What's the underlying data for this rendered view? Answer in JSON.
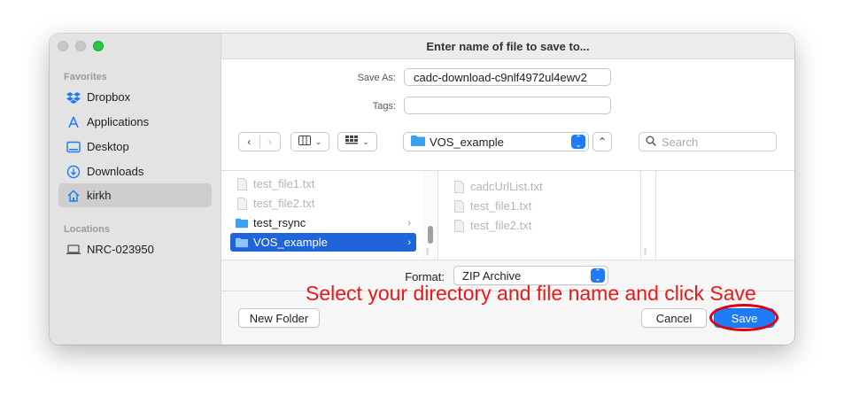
{
  "window": {
    "title": "Enter name of file to save to..."
  },
  "sidebar": {
    "favorites_heading": "Favorites",
    "favorites": [
      {
        "label": "Dropbox",
        "icon": "dropbox-icon"
      },
      {
        "label": "Applications",
        "icon": "applications-icon"
      },
      {
        "label": "Desktop",
        "icon": "desktop-icon"
      },
      {
        "label": "Downloads",
        "icon": "downloads-icon"
      },
      {
        "label": "kirkh",
        "icon": "home-icon",
        "selected": true
      }
    ],
    "locations_heading": "Locations",
    "locations": [
      {
        "label": "NRC-023950",
        "icon": "computer-icon"
      }
    ]
  },
  "form": {
    "save_as_label": "Save As:",
    "save_as_value": "cadc-download-c9nlf4972ul4ewv2",
    "tags_label": "Tags:",
    "tags_value": ""
  },
  "toolbar": {
    "location": "VOS_example",
    "search_placeholder": "Search"
  },
  "browser": {
    "column1": [
      {
        "label": "test_file1.txt",
        "kind": "file",
        "dimmed": true
      },
      {
        "label": "test_file2.txt",
        "kind": "file",
        "dimmed": true
      },
      {
        "label": "test_rsync",
        "kind": "folder"
      },
      {
        "label": "VOS_example",
        "kind": "folder",
        "selected": true
      }
    ],
    "column2": [
      {
        "label": "cadcUrlList.txt",
        "kind": "file",
        "dimmed": true
      },
      {
        "label": "test_file1.txt",
        "kind": "file",
        "dimmed": true
      },
      {
        "label": "test_file2.txt",
        "kind": "file",
        "dimmed": true
      }
    ]
  },
  "format": {
    "label": "Format:",
    "value": "ZIP Archive"
  },
  "actions": {
    "new_folder": "New Folder",
    "cancel": "Cancel",
    "save": "Save"
  },
  "annotation": {
    "text": "Select your directory and file name and click Save",
    "color": "#ec1818"
  },
  "colors": {
    "accent": "#1f7cf7",
    "selection": "#1f64d8",
    "folder": "#3aa0f0"
  }
}
